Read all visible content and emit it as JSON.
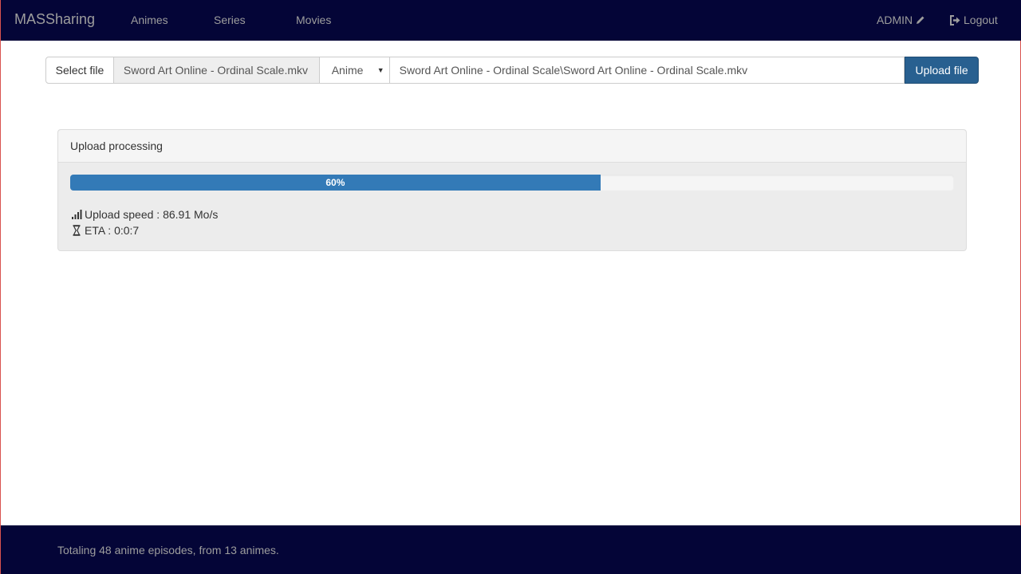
{
  "navbar": {
    "brand": "MASSharing",
    "links": [
      "Animes",
      "Series",
      "Movies"
    ],
    "user_label": "ADMIN",
    "user_icon": "pencil-icon",
    "logout_label": "Logout",
    "logout_icon": "logout-icon"
  },
  "upload": {
    "select_label": "Select file",
    "file_name": "Sword Art Online - Ordinal Scale.mkv",
    "type_selected": "Anime",
    "path_value": "Sword Art Online - Ordinal Scale\\Sword Art Online - Ordinal Scale.mkv",
    "upload_label": "Upload file"
  },
  "panel": {
    "heading": "Upload processing",
    "progress_percent": 60,
    "progress_label": "60%",
    "speed_text": "Upload speed : 86.91 Mo/s",
    "speed_icon": "signal-icon",
    "eta_text": "ETA : 0:0:7",
    "eta_icon": "hourglass-icon"
  },
  "footer": {
    "text": "Totaling 48 anime episodes, from 13 animes."
  },
  "colors": {
    "navbar_bg": "#040537",
    "primary": "#337ab7",
    "upload_button": "#286090"
  }
}
